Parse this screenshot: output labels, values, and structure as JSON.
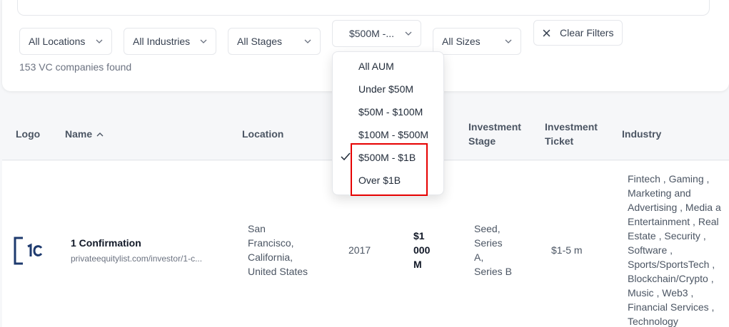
{
  "filters": {
    "locations": "All Locations",
    "industries": "All Industries",
    "stages": "All Stages",
    "aum_selected": "$500M -...",
    "sizes": "All Sizes",
    "clear": "Clear Filters"
  },
  "results_count": "153 VC companies found",
  "table": {
    "headers": {
      "logo": "Logo",
      "name": "Name",
      "location": "Location",
      "stage_1": "Investment",
      "stage_2": "Stage",
      "ticket_1": "Investment",
      "ticket_2": "Ticket",
      "industry": "Industry"
    },
    "row": {
      "name": "1 Confirmation",
      "url": "privateequitylist.com/investor/1-c...",
      "location": [
        "San",
        "Francisco,",
        "California,",
        "United States"
      ],
      "founded": "2017",
      "aum": [
        "$1",
        "000",
        "M"
      ],
      "stages": [
        "Seed,",
        "Series",
        "A,",
        "Series B"
      ],
      "ticket": "$1-5 m",
      "industries": [
        "Fintech , Gaming ,",
        "Marketing and",
        "Advertising , Media a",
        "Entertainment , Real",
        "Estate , Security ,",
        "Software ,",
        "Sports/SportsTech ,",
        "Blockchain/Crypto ,",
        "Music , Web3 ,",
        "Financial Services ,",
        "Technology"
      ]
    }
  },
  "aum_dropdown": {
    "options": [
      "All AUM",
      "Under $50M",
      "$50M - $100M",
      "$100M - $500M",
      "$500M - $1B",
      "Over $1B"
    ],
    "selected_index": 4
  },
  "colors": {
    "highlight": "#e60000",
    "logo_blue": "#1e3a6e"
  }
}
